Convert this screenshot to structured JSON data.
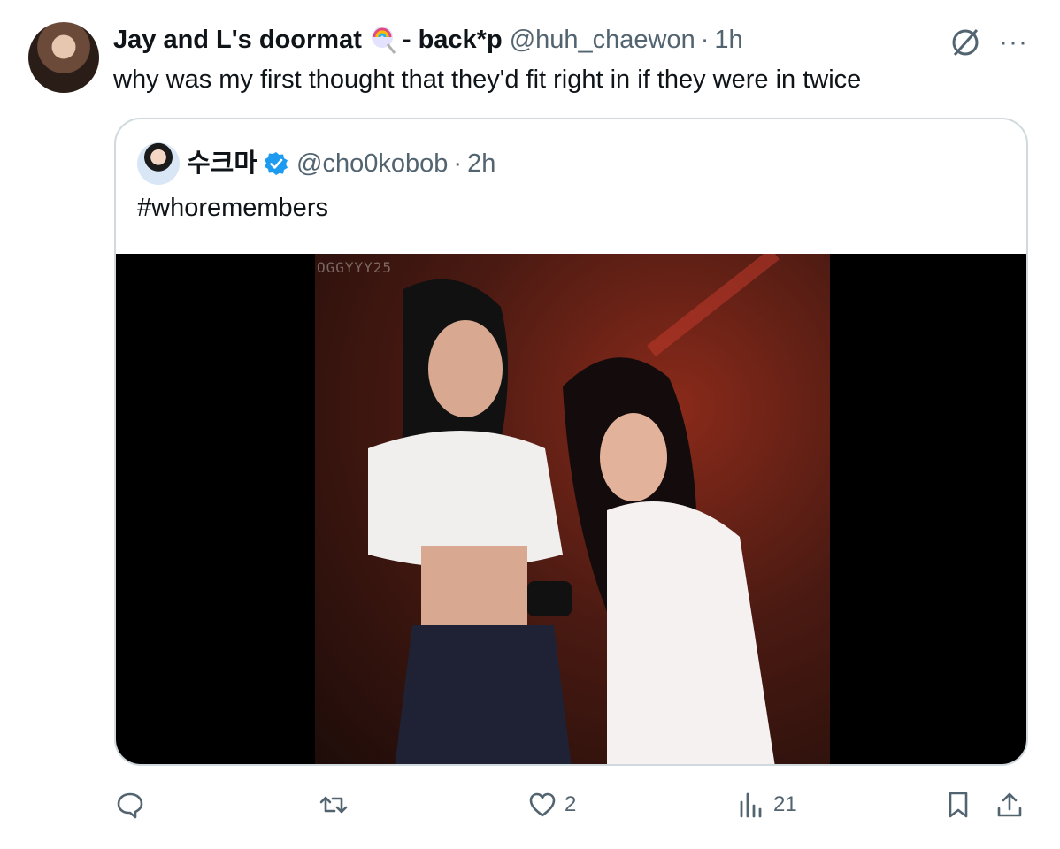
{
  "tweet": {
    "display_name": "Jay and L's doormat",
    "name_suffix": "- back*p",
    "handle": "@huh_chaewon",
    "separator": "·",
    "time": "1h",
    "text": "why was my first thought that they'd fit right in if they were in twice",
    "more_label": "···"
  },
  "quote": {
    "display_name": "수크마",
    "handle": "@cho0kobob",
    "separator": "·",
    "time": "2h",
    "text": "#whoremembers",
    "watermark": "OGGYYY25"
  },
  "actions": {
    "reply_count": "",
    "retweet_count": "",
    "like_count": "2",
    "views_count": "21"
  },
  "icons": [
    "lollipop-icon",
    "grok-icon",
    "more-icon",
    "verified-icon",
    "reply-icon",
    "retweet-icon",
    "like-icon",
    "views-icon",
    "bookmark-icon",
    "share-icon"
  ],
  "colors": {
    "verified": "#1d9bf0",
    "secondary_text": "#536471"
  }
}
